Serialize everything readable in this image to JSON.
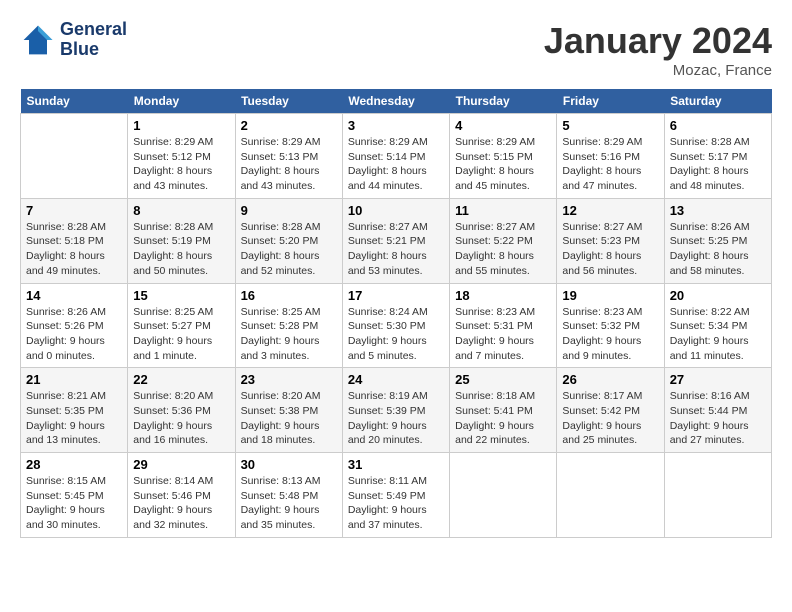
{
  "header": {
    "logo_line1": "General",
    "logo_line2": "Blue",
    "month": "January 2024",
    "location": "Mozac, France"
  },
  "weekdays": [
    "Sunday",
    "Monday",
    "Tuesday",
    "Wednesday",
    "Thursday",
    "Friday",
    "Saturday"
  ],
  "weeks": [
    [
      {
        "day": "",
        "sunrise": "",
        "sunset": "",
        "daylight": ""
      },
      {
        "day": "1",
        "sunrise": "Sunrise: 8:29 AM",
        "sunset": "Sunset: 5:12 PM",
        "daylight": "Daylight: 8 hours and 43 minutes."
      },
      {
        "day": "2",
        "sunrise": "Sunrise: 8:29 AM",
        "sunset": "Sunset: 5:13 PM",
        "daylight": "Daylight: 8 hours and 43 minutes."
      },
      {
        "day": "3",
        "sunrise": "Sunrise: 8:29 AM",
        "sunset": "Sunset: 5:14 PM",
        "daylight": "Daylight: 8 hours and 44 minutes."
      },
      {
        "day": "4",
        "sunrise": "Sunrise: 8:29 AM",
        "sunset": "Sunset: 5:15 PM",
        "daylight": "Daylight: 8 hours and 45 minutes."
      },
      {
        "day": "5",
        "sunrise": "Sunrise: 8:29 AM",
        "sunset": "Sunset: 5:16 PM",
        "daylight": "Daylight: 8 hours and 47 minutes."
      },
      {
        "day": "6",
        "sunrise": "Sunrise: 8:28 AM",
        "sunset": "Sunset: 5:17 PM",
        "daylight": "Daylight: 8 hours and 48 minutes."
      }
    ],
    [
      {
        "day": "7",
        "sunrise": "Sunrise: 8:28 AM",
        "sunset": "Sunset: 5:18 PM",
        "daylight": "Daylight: 8 hours and 49 minutes."
      },
      {
        "day": "8",
        "sunrise": "Sunrise: 8:28 AM",
        "sunset": "Sunset: 5:19 PM",
        "daylight": "Daylight: 8 hours and 50 minutes."
      },
      {
        "day": "9",
        "sunrise": "Sunrise: 8:28 AM",
        "sunset": "Sunset: 5:20 PM",
        "daylight": "Daylight: 8 hours and 52 minutes."
      },
      {
        "day": "10",
        "sunrise": "Sunrise: 8:27 AM",
        "sunset": "Sunset: 5:21 PM",
        "daylight": "Daylight: 8 hours and 53 minutes."
      },
      {
        "day": "11",
        "sunrise": "Sunrise: 8:27 AM",
        "sunset": "Sunset: 5:22 PM",
        "daylight": "Daylight: 8 hours and 55 minutes."
      },
      {
        "day": "12",
        "sunrise": "Sunrise: 8:27 AM",
        "sunset": "Sunset: 5:23 PM",
        "daylight": "Daylight: 8 hours and 56 minutes."
      },
      {
        "day": "13",
        "sunrise": "Sunrise: 8:26 AM",
        "sunset": "Sunset: 5:25 PM",
        "daylight": "Daylight: 8 hours and 58 minutes."
      }
    ],
    [
      {
        "day": "14",
        "sunrise": "Sunrise: 8:26 AM",
        "sunset": "Sunset: 5:26 PM",
        "daylight": "Daylight: 9 hours and 0 minutes."
      },
      {
        "day": "15",
        "sunrise": "Sunrise: 8:25 AM",
        "sunset": "Sunset: 5:27 PM",
        "daylight": "Daylight: 9 hours and 1 minute."
      },
      {
        "day": "16",
        "sunrise": "Sunrise: 8:25 AM",
        "sunset": "Sunset: 5:28 PM",
        "daylight": "Daylight: 9 hours and 3 minutes."
      },
      {
        "day": "17",
        "sunrise": "Sunrise: 8:24 AM",
        "sunset": "Sunset: 5:30 PM",
        "daylight": "Daylight: 9 hours and 5 minutes."
      },
      {
        "day": "18",
        "sunrise": "Sunrise: 8:23 AM",
        "sunset": "Sunset: 5:31 PM",
        "daylight": "Daylight: 9 hours and 7 minutes."
      },
      {
        "day": "19",
        "sunrise": "Sunrise: 8:23 AM",
        "sunset": "Sunset: 5:32 PM",
        "daylight": "Daylight: 9 hours and 9 minutes."
      },
      {
        "day": "20",
        "sunrise": "Sunrise: 8:22 AM",
        "sunset": "Sunset: 5:34 PM",
        "daylight": "Daylight: 9 hours and 11 minutes."
      }
    ],
    [
      {
        "day": "21",
        "sunrise": "Sunrise: 8:21 AM",
        "sunset": "Sunset: 5:35 PM",
        "daylight": "Daylight: 9 hours and 13 minutes."
      },
      {
        "day": "22",
        "sunrise": "Sunrise: 8:20 AM",
        "sunset": "Sunset: 5:36 PM",
        "daylight": "Daylight: 9 hours and 16 minutes."
      },
      {
        "day": "23",
        "sunrise": "Sunrise: 8:20 AM",
        "sunset": "Sunset: 5:38 PM",
        "daylight": "Daylight: 9 hours and 18 minutes."
      },
      {
        "day": "24",
        "sunrise": "Sunrise: 8:19 AM",
        "sunset": "Sunset: 5:39 PM",
        "daylight": "Daylight: 9 hours and 20 minutes."
      },
      {
        "day": "25",
        "sunrise": "Sunrise: 8:18 AM",
        "sunset": "Sunset: 5:41 PM",
        "daylight": "Daylight: 9 hours and 22 minutes."
      },
      {
        "day": "26",
        "sunrise": "Sunrise: 8:17 AM",
        "sunset": "Sunset: 5:42 PM",
        "daylight": "Daylight: 9 hours and 25 minutes."
      },
      {
        "day": "27",
        "sunrise": "Sunrise: 8:16 AM",
        "sunset": "Sunset: 5:44 PM",
        "daylight": "Daylight: 9 hours and 27 minutes."
      }
    ],
    [
      {
        "day": "28",
        "sunrise": "Sunrise: 8:15 AM",
        "sunset": "Sunset: 5:45 PM",
        "daylight": "Daylight: 9 hours and 30 minutes."
      },
      {
        "day": "29",
        "sunrise": "Sunrise: 8:14 AM",
        "sunset": "Sunset: 5:46 PM",
        "daylight": "Daylight: 9 hours and 32 minutes."
      },
      {
        "day": "30",
        "sunrise": "Sunrise: 8:13 AM",
        "sunset": "Sunset: 5:48 PM",
        "daylight": "Daylight: 9 hours and 35 minutes."
      },
      {
        "day": "31",
        "sunrise": "Sunrise: 8:11 AM",
        "sunset": "Sunset: 5:49 PM",
        "daylight": "Daylight: 9 hours and 37 minutes."
      },
      {
        "day": "",
        "sunrise": "",
        "sunset": "",
        "daylight": ""
      },
      {
        "day": "",
        "sunrise": "",
        "sunset": "",
        "daylight": ""
      },
      {
        "day": "",
        "sunrise": "",
        "sunset": "",
        "daylight": ""
      }
    ]
  ]
}
